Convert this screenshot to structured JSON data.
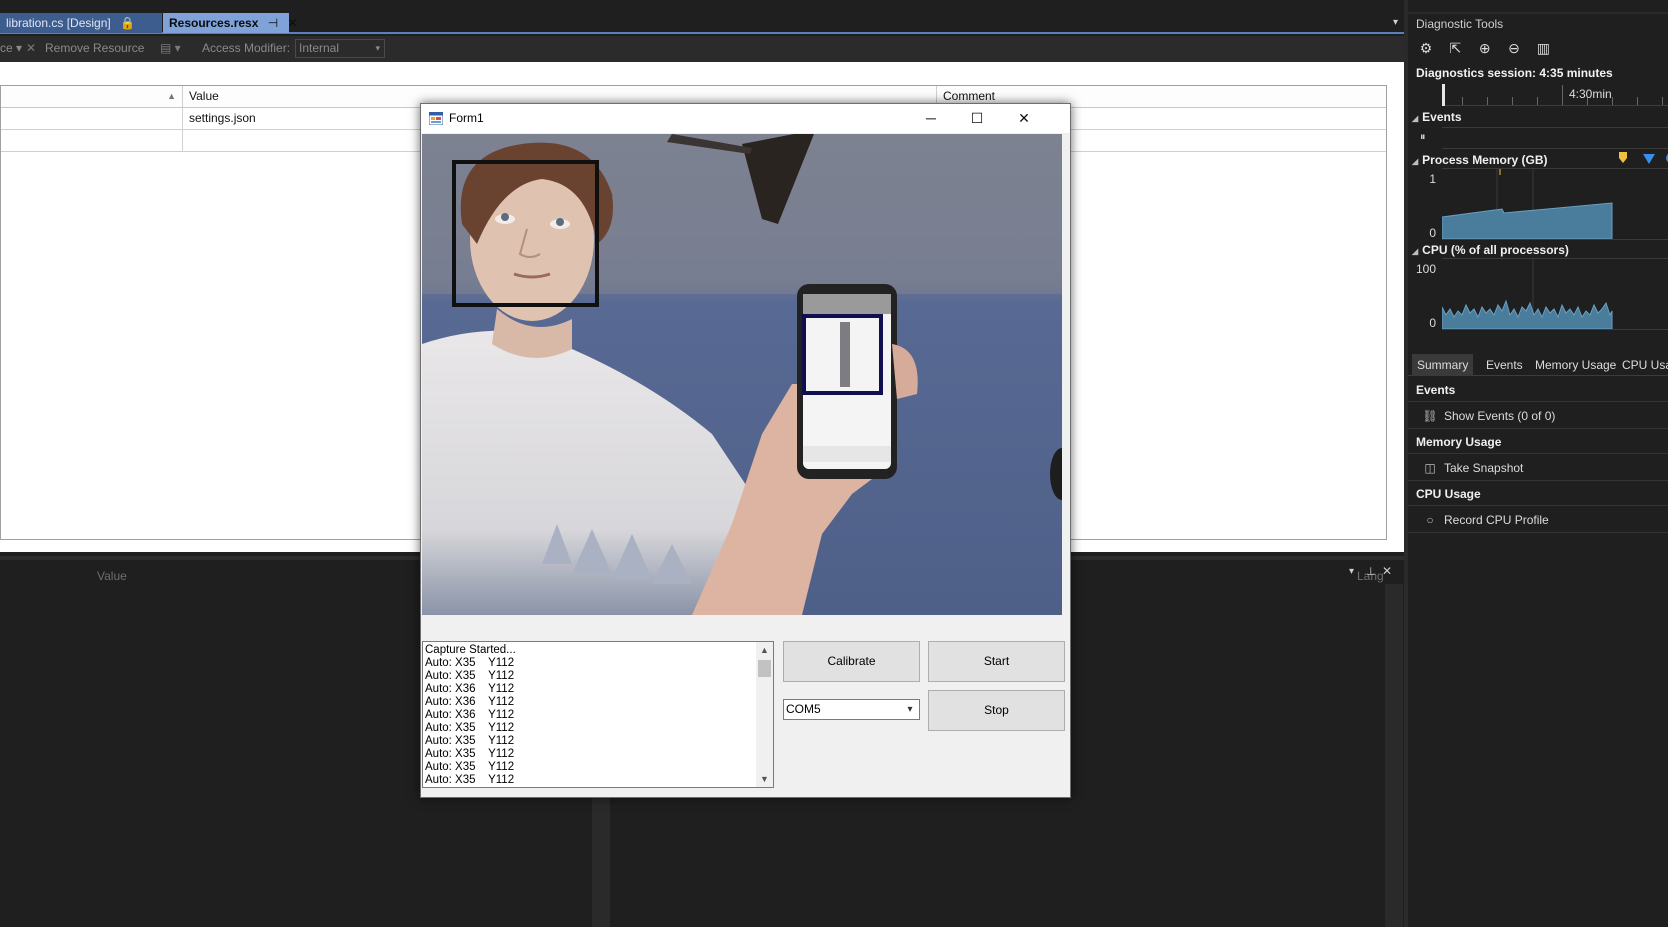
{
  "ide": {
    "tabs": [
      {
        "label": "libration.cs [Design]",
        "glyph": "🔒"
      },
      {
        "label": "Resources.resx",
        "pin": "⊣",
        "close": "✕"
      }
    ],
    "toolbar": {
      "add_fragment": "ce ▾",
      "remove_resource": "Remove Resource",
      "access_modifier_label": "Access Modifier:",
      "access_modifier_value": "Internal"
    },
    "grid": {
      "columns": [
        "",
        "Value",
        "Comment"
      ],
      "rows": [
        {
          "name": "",
          "value": "settings.json",
          "comment": ""
        },
        {
          "name": "",
          "value": "",
          "comment": ""
        }
      ]
    },
    "lower_pane": {
      "columns": [
        "Value",
        "Lang"
      ]
    }
  },
  "diagnostics": {
    "title": "Diagnostic Tools",
    "session": "Diagnostics session: 4:35 minutes",
    "ruler_mark": "4:30min",
    "sections": {
      "events": "Events",
      "process_memory": "Process Memory (GB)",
      "cpu": "CPU (% of all processors)"
    },
    "memory_axis": {
      "max": "1",
      "min": "0"
    },
    "cpu_axis": {
      "max": "100",
      "min": "0"
    },
    "tabs": [
      "Summary",
      "Events",
      "Memory Usage",
      "CPU Usag"
    ],
    "summary": {
      "events_header": "Events",
      "show_events": "Show Events (0 of 0)",
      "memory_header": "Memory Usage",
      "take_snapshot": "Take Snapshot",
      "cpu_header": "CPU Usage",
      "record_cpu": "Record CPU Profile"
    }
  },
  "form1": {
    "title": "Form1",
    "log": [
      "Capture Started...",
      "Auto: X35    Y112",
      "Auto: X35    Y112",
      "Auto: X36    Y112",
      "Auto: X36    Y112",
      "Auto: X36    Y112",
      "Auto: X35    Y112",
      "Auto: X35    Y112",
      "Auto: X35    Y112",
      "Auto: X35    Y112",
      "Auto: X35    Y112"
    ],
    "buttons": {
      "calibrate": "Calibrate",
      "start": "Start",
      "stop": "Stop"
    },
    "port_select": "COM5"
  },
  "colors": {
    "accent": "#7fa2d8",
    "chart_fill": "#4a7c9c",
    "marker_yellow": "#f0c040",
    "marker_blue": "#3a8ee6"
  }
}
